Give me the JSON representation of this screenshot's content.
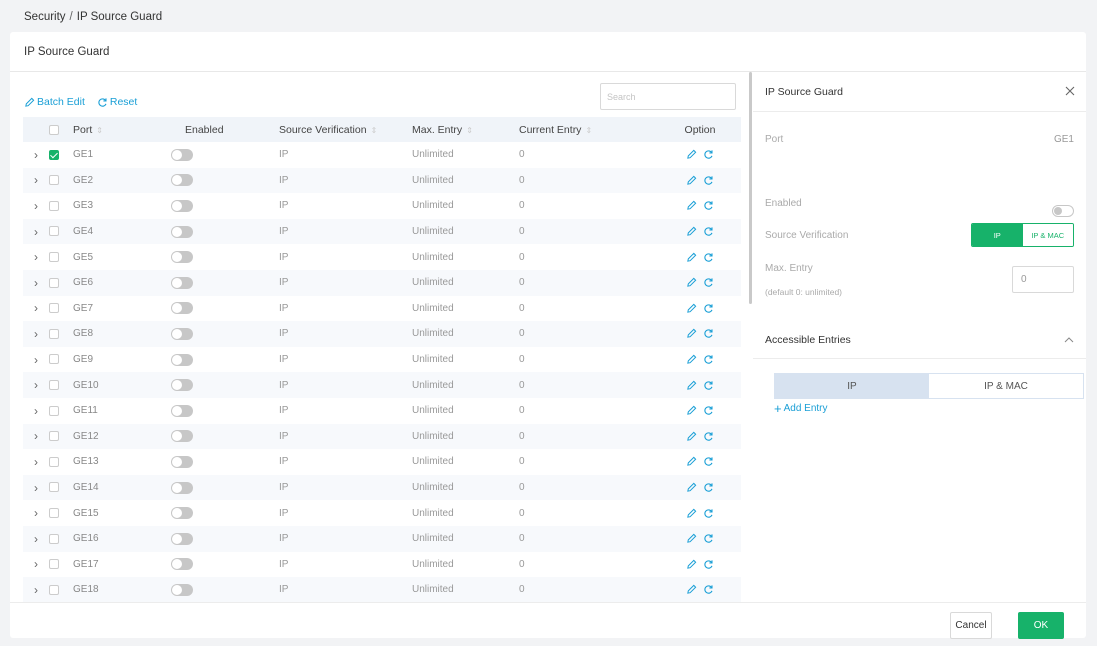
{
  "breadcrumb": {
    "section": "Security",
    "separator": "/",
    "page": "IP Source Guard"
  },
  "card_title": "IP Source Guard",
  "toolbar": {
    "batch_edit": "Batch Edit",
    "reset": "Reset"
  },
  "search": {
    "placeholder": "Search"
  },
  "table": {
    "headers": {
      "port": "Port",
      "enabled": "Enabled",
      "source_verification": "Source Verification",
      "max_entry": "Max. Entry",
      "current_entry": "Current Entry",
      "option": "Option"
    },
    "rows": [
      {
        "port": "GE1",
        "checked": true,
        "enabled": false,
        "source": "IP",
        "max": "Unlimited",
        "current": "0"
      },
      {
        "port": "GE2",
        "checked": false,
        "enabled": false,
        "source": "IP",
        "max": "Unlimited",
        "current": "0"
      },
      {
        "port": "GE3",
        "checked": false,
        "enabled": false,
        "source": "IP",
        "max": "Unlimited",
        "current": "0"
      },
      {
        "port": "GE4",
        "checked": false,
        "enabled": false,
        "source": "IP",
        "max": "Unlimited",
        "current": "0"
      },
      {
        "port": "GE5",
        "checked": false,
        "enabled": false,
        "source": "IP",
        "max": "Unlimited",
        "current": "0"
      },
      {
        "port": "GE6",
        "checked": false,
        "enabled": false,
        "source": "IP",
        "max": "Unlimited",
        "current": "0"
      },
      {
        "port": "GE7",
        "checked": false,
        "enabled": false,
        "source": "IP",
        "max": "Unlimited",
        "current": "0"
      },
      {
        "port": "GE8",
        "checked": false,
        "enabled": false,
        "source": "IP",
        "max": "Unlimited",
        "current": "0"
      },
      {
        "port": "GE9",
        "checked": false,
        "enabled": false,
        "source": "IP",
        "max": "Unlimited",
        "current": "0"
      },
      {
        "port": "GE10",
        "checked": false,
        "enabled": false,
        "source": "IP",
        "max": "Unlimited",
        "current": "0"
      },
      {
        "port": "GE11",
        "checked": false,
        "enabled": false,
        "source": "IP",
        "max": "Unlimited",
        "current": "0"
      },
      {
        "port": "GE12",
        "checked": false,
        "enabled": false,
        "source": "IP",
        "max": "Unlimited",
        "current": "0"
      },
      {
        "port": "GE13",
        "checked": false,
        "enabled": false,
        "source": "IP",
        "max": "Unlimited",
        "current": "0"
      },
      {
        "port": "GE14",
        "checked": false,
        "enabled": false,
        "source": "IP",
        "max": "Unlimited",
        "current": "0"
      },
      {
        "port": "GE15",
        "checked": false,
        "enabled": false,
        "source": "IP",
        "max": "Unlimited",
        "current": "0"
      },
      {
        "port": "GE16",
        "checked": false,
        "enabled": false,
        "source": "IP",
        "max": "Unlimited",
        "current": "0"
      },
      {
        "port": "GE17",
        "checked": false,
        "enabled": false,
        "source": "IP",
        "max": "Unlimited",
        "current": "0"
      },
      {
        "port": "GE18",
        "checked": false,
        "enabled": false,
        "source": "IP",
        "max": "Unlimited",
        "current": "0"
      }
    ]
  },
  "panel": {
    "title": "IP Source Guard",
    "port_label": "Port",
    "port_value": "GE1",
    "enabled_label": "Enabled",
    "enabled": false,
    "source_label": "Source Verification",
    "source_options": [
      "IP",
      "IP & MAC"
    ],
    "source_selected": "IP",
    "max_label": "Max. Entry",
    "max_hint": "(default 0: unlimited)",
    "max_value": "0",
    "accessible_title": "Accessible Entries",
    "tabs": [
      "IP",
      "IP & MAC"
    ],
    "add_entry": "Add Entry"
  },
  "footer": {
    "cancel": "Cancel",
    "ok": "OK"
  },
  "colors": {
    "accent_green": "#17b26a",
    "link_blue": "#1a9fd6",
    "row_stripe": "#f7f9fc",
    "header_bg": "#f0f4f9"
  }
}
